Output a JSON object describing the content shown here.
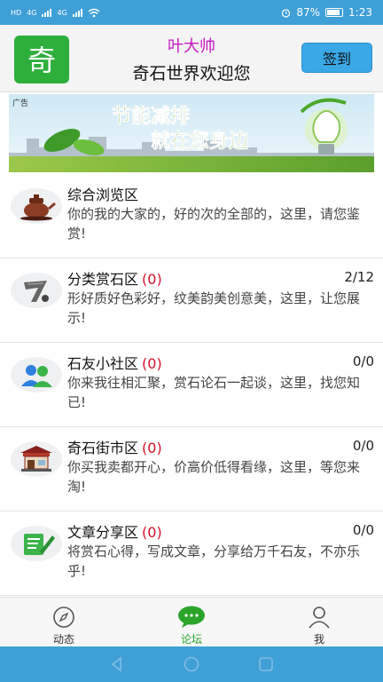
{
  "status_bar": {
    "left": [
      "HD",
      "4G",
      "4G"
    ],
    "battery": "87%",
    "time": "1:23"
  },
  "header": {
    "logo_char": "奇",
    "user_name": "叶大帅",
    "welcome": "奇石世界欢迎您",
    "signin_label": "签到"
  },
  "ad": {
    "label": "广告",
    "headline_line1": "节能减排",
    "headline_line2": "就在您身边"
  },
  "forum": {
    "items": [
      {
        "icon": "teapot-icon",
        "title": "综合浏览区",
        "count": "",
        "pages": "",
        "desc": "你的我的大家的，好的次的全部的，这里，请您鉴赏!"
      },
      {
        "icon": "stone-7-icon",
        "title": "分类赏石区",
        "count": "(0)",
        "pages": "2/12",
        "desc": "形好质好色彩好，纹美韵美创意美，这里，让您展示!"
      },
      {
        "icon": "community-users-icon",
        "title": "石友小社区",
        "count": "(0)",
        "pages": "0/0",
        "desc": "你来我往相汇聚，赏石论石一起谈，这里，找您知已!"
      },
      {
        "icon": "market-shop-icon",
        "title": "奇石街市区",
        "count": "(0)",
        "pages": "0/0",
        "desc": "你买我卖都开心，价高价低得看缘，这里，等您来淘!"
      },
      {
        "icon": "article-writing-icon",
        "title": "文章分享区",
        "count": "(0)",
        "pages": "0/0",
        "desc": "将赏石心得，写成文章，分享给万千石友，不亦乐乎!"
      }
    ]
  },
  "bottom_nav": {
    "items": [
      {
        "label": "动态",
        "icon": "compass-icon",
        "active": false
      },
      {
        "label": "论坛",
        "icon": "chat-bubble-icon",
        "active": true
      },
      {
        "label": "我",
        "icon": "person-icon",
        "active": false
      }
    ]
  },
  "colors": {
    "status_bar": "#3f9fd7",
    "accent_green": "#2aa52a",
    "count_red": "#d0102a",
    "name_magenta": "#c418c4",
    "signin_blue": "#3aa8e6"
  }
}
